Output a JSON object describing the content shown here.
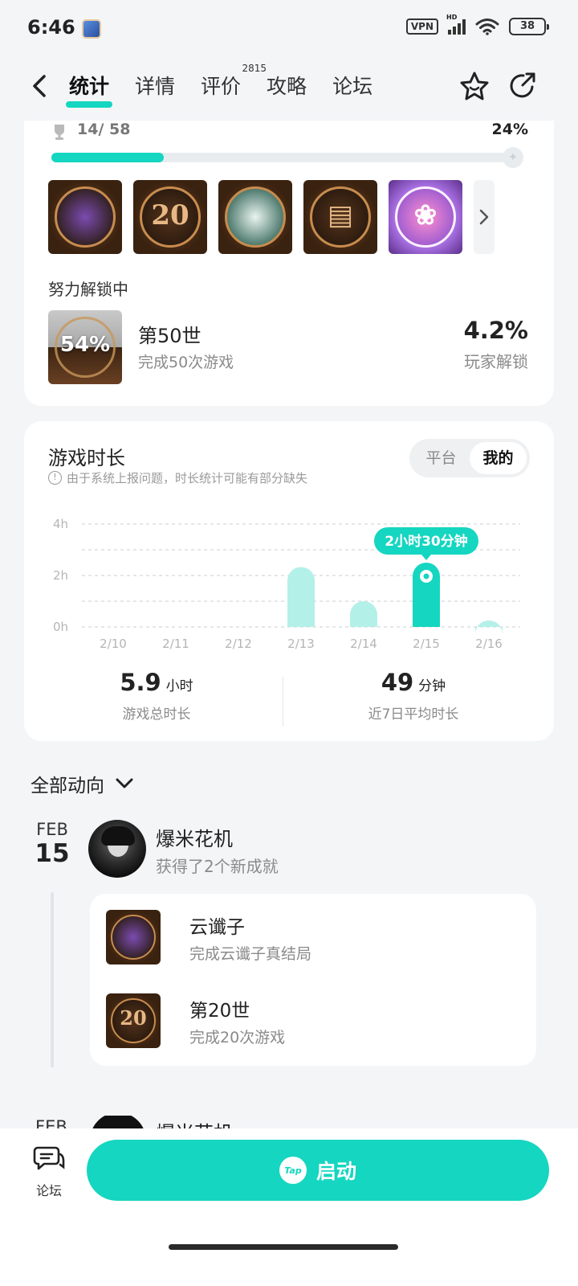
{
  "status_bar": {
    "time": "6:46",
    "vpn_label": "VPN",
    "network_label": "HD",
    "battery": "38"
  },
  "nav": {
    "tabs": [
      {
        "label": "统计",
        "active": true
      },
      {
        "label": "详情",
        "active": false
      },
      {
        "label": "评价",
        "active": false,
        "badge": "2815"
      },
      {
        "label": "攻略",
        "active": false
      },
      {
        "label": "论坛",
        "active": false
      }
    ],
    "icons": [
      "back-icon",
      "star-icon",
      "share-icon"
    ]
  },
  "achievements": {
    "count": "14/ 58",
    "percent": "24%",
    "progress": 0.24,
    "badges": [
      {
        "name": "portrait-badge",
        "glyph": ""
      },
      {
        "name": "twenty-badge",
        "glyph": "20"
      },
      {
        "name": "portrait-badge",
        "glyph": ""
      },
      {
        "name": "book-badge",
        "glyph": "▤"
      },
      {
        "name": "lotus-badge",
        "glyph": "❀"
      }
    ],
    "unlocking_label": "努力解锁中",
    "unlocking": {
      "progress_label": "54%",
      "title": "第50世",
      "description": "完成50次游戏",
      "rate": "4.2%",
      "rate_label": "玩家解锁"
    }
  },
  "playtime": {
    "title": "游戏时长",
    "notice": "由于系统上报问题，时长统计可能有部分缺失",
    "toggle": [
      "平台",
      "我的"
    ],
    "toggle_active": 1,
    "total_value": "5.9",
    "total_unit": "小时",
    "total_label": "游戏总时长",
    "avg_value": "49",
    "avg_unit": "分钟",
    "avg_label": "近7日平均时长"
  },
  "chart_data": {
    "type": "bar",
    "categories": [
      "2/10",
      "2/11",
      "2/12",
      "2/13",
      "2/14",
      "2/15",
      "2/16"
    ],
    "values": [
      0,
      0,
      0,
      2.33,
      1.0,
      2.5,
      0.25
    ],
    "y_ticks": [
      "4h",
      "2h",
      "0h"
    ],
    "ylim": [
      0,
      4
    ],
    "highlight_index": 5,
    "tooltip": "2小时30分钟",
    "bar_color": "#b3f0e8",
    "highlight_color": "#15d6c0",
    "title": "",
    "xlabel": "",
    "ylabel": ""
  },
  "feed": {
    "header": "全部动向",
    "entries": [
      {
        "month": "FEB",
        "day": "15",
        "user": "爆米花机",
        "action": "获得了2个新成就",
        "achievements": [
          {
            "title": "云谶子",
            "description": "完成云谶子真结局",
            "glyph": ""
          },
          {
            "title": "第20世",
            "description": "完成20次游戏",
            "glyph": "20"
          }
        ]
      }
    ],
    "peek": {
      "month": "FEB",
      "user": "爆米花机"
    }
  },
  "bottom": {
    "forum_label": "论坛",
    "launch_label": "启动",
    "launch_logo": "Tap"
  }
}
